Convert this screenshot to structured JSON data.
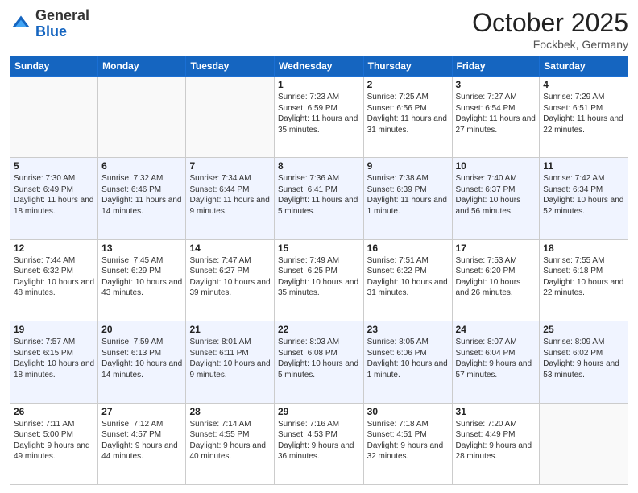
{
  "header": {
    "logo_general": "General",
    "logo_blue": "Blue",
    "month": "October 2025",
    "location": "Fockbek, Germany"
  },
  "weekdays": [
    "Sunday",
    "Monday",
    "Tuesday",
    "Wednesday",
    "Thursday",
    "Friday",
    "Saturday"
  ],
  "weeks": [
    [
      {
        "day": "",
        "info": ""
      },
      {
        "day": "",
        "info": ""
      },
      {
        "day": "",
        "info": ""
      },
      {
        "day": "1",
        "info": "Sunrise: 7:23 AM\nSunset: 6:59 PM\nDaylight: 11 hours and 35 minutes."
      },
      {
        "day": "2",
        "info": "Sunrise: 7:25 AM\nSunset: 6:56 PM\nDaylight: 11 hours and 31 minutes."
      },
      {
        "day": "3",
        "info": "Sunrise: 7:27 AM\nSunset: 6:54 PM\nDaylight: 11 hours and 27 minutes."
      },
      {
        "day": "4",
        "info": "Sunrise: 7:29 AM\nSunset: 6:51 PM\nDaylight: 11 hours and 22 minutes."
      }
    ],
    [
      {
        "day": "5",
        "info": "Sunrise: 7:30 AM\nSunset: 6:49 PM\nDaylight: 11 hours and 18 minutes."
      },
      {
        "day": "6",
        "info": "Sunrise: 7:32 AM\nSunset: 6:46 PM\nDaylight: 11 hours and 14 minutes."
      },
      {
        "day": "7",
        "info": "Sunrise: 7:34 AM\nSunset: 6:44 PM\nDaylight: 11 hours and 9 minutes."
      },
      {
        "day": "8",
        "info": "Sunrise: 7:36 AM\nSunset: 6:41 PM\nDaylight: 11 hours and 5 minutes."
      },
      {
        "day": "9",
        "info": "Sunrise: 7:38 AM\nSunset: 6:39 PM\nDaylight: 11 hours and 1 minute."
      },
      {
        "day": "10",
        "info": "Sunrise: 7:40 AM\nSunset: 6:37 PM\nDaylight: 10 hours and 56 minutes."
      },
      {
        "day": "11",
        "info": "Sunrise: 7:42 AM\nSunset: 6:34 PM\nDaylight: 10 hours and 52 minutes."
      }
    ],
    [
      {
        "day": "12",
        "info": "Sunrise: 7:44 AM\nSunset: 6:32 PM\nDaylight: 10 hours and 48 minutes."
      },
      {
        "day": "13",
        "info": "Sunrise: 7:45 AM\nSunset: 6:29 PM\nDaylight: 10 hours and 43 minutes."
      },
      {
        "day": "14",
        "info": "Sunrise: 7:47 AM\nSunset: 6:27 PM\nDaylight: 10 hours and 39 minutes."
      },
      {
        "day": "15",
        "info": "Sunrise: 7:49 AM\nSunset: 6:25 PM\nDaylight: 10 hours and 35 minutes."
      },
      {
        "day": "16",
        "info": "Sunrise: 7:51 AM\nSunset: 6:22 PM\nDaylight: 10 hours and 31 minutes."
      },
      {
        "day": "17",
        "info": "Sunrise: 7:53 AM\nSunset: 6:20 PM\nDaylight: 10 hours and 26 minutes."
      },
      {
        "day": "18",
        "info": "Sunrise: 7:55 AM\nSunset: 6:18 PM\nDaylight: 10 hours and 22 minutes."
      }
    ],
    [
      {
        "day": "19",
        "info": "Sunrise: 7:57 AM\nSunset: 6:15 PM\nDaylight: 10 hours and 18 minutes."
      },
      {
        "day": "20",
        "info": "Sunrise: 7:59 AM\nSunset: 6:13 PM\nDaylight: 10 hours and 14 minutes."
      },
      {
        "day": "21",
        "info": "Sunrise: 8:01 AM\nSunset: 6:11 PM\nDaylight: 10 hours and 9 minutes."
      },
      {
        "day": "22",
        "info": "Sunrise: 8:03 AM\nSunset: 6:08 PM\nDaylight: 10 hours and 5 minutes."
      },
      {
        "day": "23",
        "info": "Sunrise: 8:05 AM\nSunset: 6:06 PM\nDaylight: 10 hours and 1 minute."
      },
      {
        "day": "24",
        "info": "Sunrise: 8:07 AM\nSunset: 6:04 PM\nDaylight: 9 hours and 57 minutes."
      },
      {
        "day": "25",
        "info": "Sunrise: 8:09 AM\nSunset: 6:02 PM\nDaylight: 9 hours and 53 minutes."
      }
    ],
    [
      {
        "day": "26",
        "info": "Sunrise: 7:11 AM\nSunset: 5:00 PM\nDaylight: 9 hours and 49 minutes."
      },
      {
        "day": "27",
        "info": "Sunrise: 7:12 AM\nSunset: 4:57 PM\nDaylight: 9 hours and 44 minutes."
      },
      {
        "day": "28",
        "info": "Sunrise: 7:14 AM\nSunset: 4:55 PM\nDaylight: 9 hours and 40 minutes."
      },
      {
        "day": "29",
        "info": "Sunrise: 7:16 AM\nSunset: 4:53 PM\nDaylight: 9 hours and 36 minutes."
      },
      {
        "day": "30",
        "info": "Sunrise: 7:18 AM\nSunset: 4:51 PM\nDaylight: 9 hours and 32 minutes."
      },
      {
        "day": "31",
        "info": "Sunrise: 7:20 AM\nSunset: 4:49 PM\nDaylight: 9 hours and 28 minutes."
      },
      {
        "day": "",
        "info": ""
      }
    ]
  ]
}
